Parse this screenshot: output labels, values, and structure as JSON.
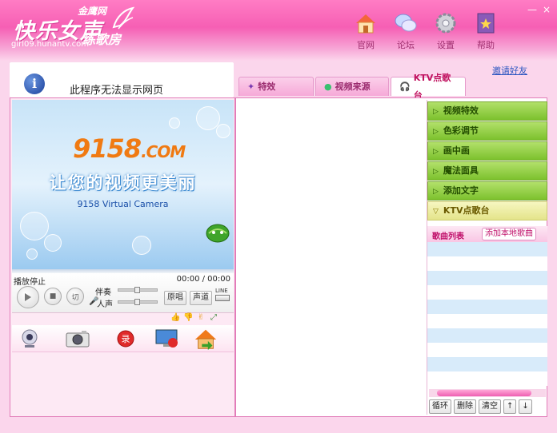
{
  "brand": {
    "sub": "金鹰网",
    "title": "快乐女声",
    "tag": "练歌房",
    "url": "girl09.hunantv.com"
  },
  "window": {
    "minimize": "—",
    "close": "×"
  },
  "toolbar": [
    {
      "label": "官网",
      "icon": "house-icon"
    },
    {
      "label": "论坛",
      "icon": "chat-bubbles-icon"
    },
    {
      "label": "设置",
      "icon": "gear-icon"
    },
    {
      "label": "帮助",
      "icon": "help-book-icon"
    }
  ],
  "invite": "邀请好友",
  "ie_message": "此程序无法显示网页",
  "tabs": [
    {
      "label": "特效",
      "active": false
    },
    {
      "label": "视频来源",
      "active": false
    },
    {
      "label": "KTV点歌台",
      "active": true
    }
  ],
  "video": {
    "brand": "9158",
    "brand_suffix": ".COM",
    "slogan": "让您的视频更美丽",
    "caption": "9158 Virtual Camera"
  },
  "player": {
    "status": "播放停止",
    "time": "00:00 / 00:00",
    "stop_label": "■",
    "cut_label": "切",
    "accompany": "伴奏",
    "voice": "人声",
    "original": "原唱",
    "channel": "声道",
    "line": "LINE"
  },
  "accordion": [
    "视频特效",
    "色彩调节",
    "画中画",
    "魔法面具",
    "添加文字",
    "KTV点歌台"
  ],
  "songs": {
    "header": "歌曲列表",
    "add_local": "添加本地歌曲"
  },
  "bottom_buttons": {
    "loop": "循环",
    "delete": "删除",
    "clear": "清空"
  },
  "colors": {
    "titlebar": "#f65fb4",
    "accent": "#c0106a",
    "accordion_green": "#7cc12d"
  }
}
